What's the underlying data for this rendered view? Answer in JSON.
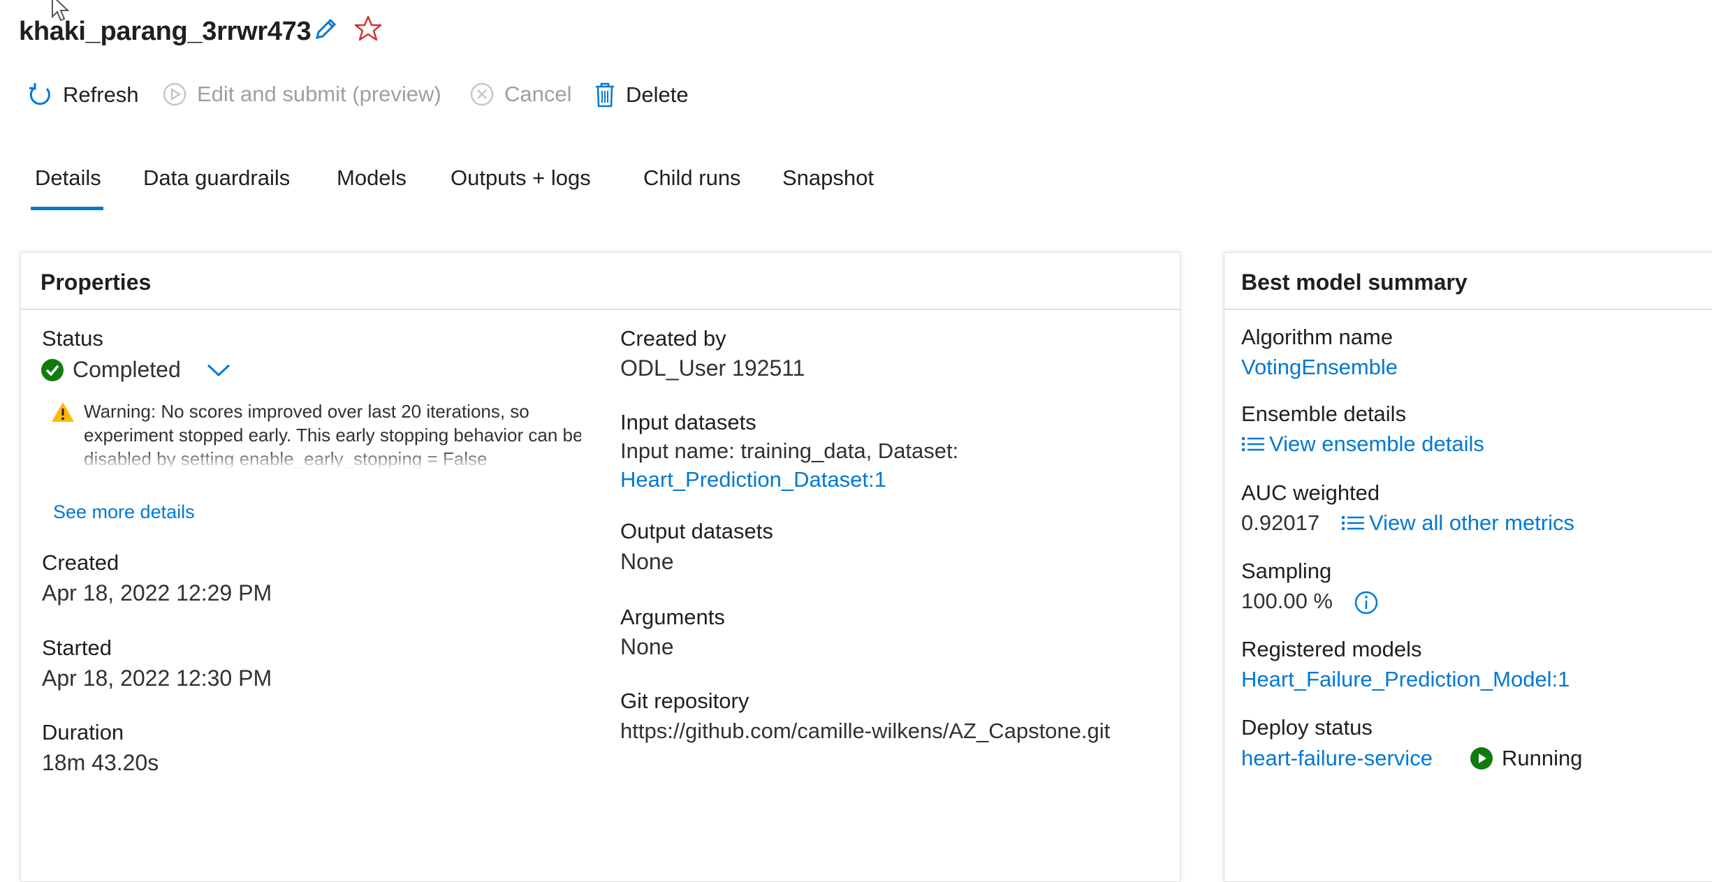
{
  "header": {
    "run_name": "khaki_parang_3rrwr473"
  },
  "toolbar": {
    "refresh_label": "Refresh",
    "edit_submit_label": "Edit and submit (preview)",
    "cancel_label": "Cancel",
    "delete_label": "Delete"
  },
  "tabs": [
    {
      "label": "Details"
    },
    {
      "label": "Data guardrails"
    },
    {
      "label": "Models"
    },
    {
      "label": "Outputs + logs"
    },
    {
      "label": "Child runs"
    },
    {
      "label": "Snapshot"
    }
  ],
  "properties": {
    "title": "Properties",
    "status_label": "Status",
    "status_value": "Completed",
    "warning_prefix": "Warning:",
    "warning_text": "No scores improved over last 20 iterations, so experiment stopped early. This early stopping behavior can be disabled by setting enable_early_stopping = False",
    "see_more_label": "See more details",
    "created_label": "Created",
    "created_value": "Apr 18, 2022 12:29 PM",
    "started_label": "Started",
    "started_value": "Apr 18, 2022 12:30 PM",
    "duration_label": "Duration",
    "duration_value": "18m 43.20s",
    "created_by_label": "Created by",
    "created_by_value": "ODL_User 192511",
    "input_datasets_label": "Input datasets",
    "input_datasets_text": "Input name: training_data, Dataset:",
    "input_dataset_link": "Heart_Prediction_Dataset:1",
    "output_datasets_label": "Output datasets",
    "output_datasets_value": "None",
    "arguments_label": "Arguments",
    "arguments_value": "None",
    "git_repo_label": "Git repository",
    "git_repo_value": "https://github.com/camille-wilkens/AZ_Capstone.git"
  },
  "best_model": {
    "title": "Best model summary",
    "algorithm_label": "Algorithm name",
    "algorithm_value": "VotingEnsemble",
    "ensemble_label": "Ensemble details",
    "ensemble_link": "View ensemble details",
    "auc_label": "AUC weighted",
    "auc_value": "0.92017",
    "metrics_link": "View all other metrics",
    "sampling_label": "Sampling",
    "sampling_value": "100.00 %",
    "registered_label": "Registered models",
    "registered_value": "Heart_Failure_Prediction_Model:1",
    "deploy_label": "Deploy status",
    "deploy_service": "heart-failure-service",
    "deploy_state": "Running"
  },
  "colors": {
    "accent": "#0078d4",
    "success": "#107c10",
    "warning": "#ffb900",
    "favorite": "#d13438"
  }
}
